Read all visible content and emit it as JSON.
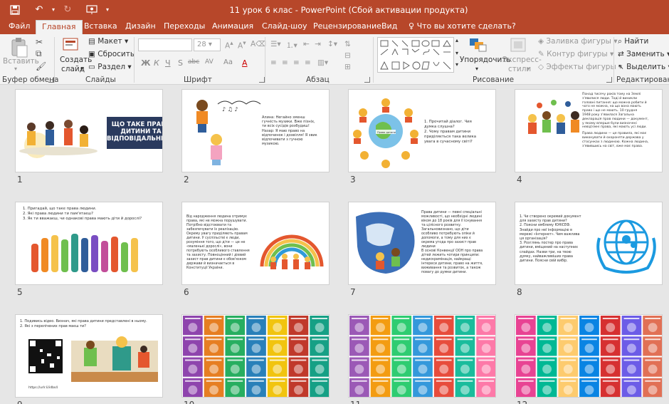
{
  "window": {
    "title": "11 урок 6 клас - PowerPoint (Сбой активации продукта)"
  },
  "tabs": [
    "Файл",
    "Главная",
    "Вставка",
    "Дизайн",
    "Переходы",
    "Анимация",
    "Слайд-шоу",
    "Рецензирование",
    "Вид"
  ],
  "active_tab": "Главная",
  "tell_me": "Что вы хотите сделать?",
  "ribbon": {
    "clipboard": {
      "paste": "Вставить",
      "label": "Буфер обмена"
    },
    "slides": {
      "new_slide": "Создать слайд",
      "new_slide_line1": "Создать",
      "new_slide_line2": "слайд",
      "layout": "Макет",
      "reset": "Сбросить",
      "section": "Раздел",
      "label": "Слайды"
    },
    "font": {
      "size": "28",
      "bold": "Ж",
      "italic": "К",
      "underline": "Ч",
      "strike": "S",
      "shadow": "abc",
      "spacing": "AV",
      "case": "Aa",
      "color": "A",
      "label": "Шрифт"
    },
    "paragraph": {
      "label": "Абзац"
    },
    "drawing": {
      "arrange": "Упорядочить",
      "quick_styles": "Экспресс-стили",
      "quick_styles_line1": "Экспресс-",
      "quick_styles_line2": "стили",
      "fill": "Заливка фигуры",
      "outline": "Контур фигуры",
      "effects": "Эффекты фигуры",
      "label": "Рисование"
    },
    "editing": {
      "find": "Найти",
      "replace": "Заменить",
      "select": "Выделить",
      "label": "Редактирование"
    }
  },
  "slides": [
    {
      "num": "1",
      "title": "ЩО ТАКЕ ПРАВА ДИТИНИ ТА ВІДПОВІДАЛЬНІСТЬ?"
    },
    {
      "num": "2",
      "lines": [
        "Алина: Негайно зменш",
        "гучність музики. Вже пізніх,",
        "ти всіх сусідів розбудиш!",
        "Назар: Я маю право на",
        "відпочинок і дозвілля! Я звик",
        "відпочивати з гучною",
        "музикою."
      ]
    },
    {
      "num": "3",
      "lines": [
        "1. Прочитай діалог. Чия",
        "    думка слушна?",
        "2. Чому правам дитини",
        "    приділяється така велика",
        "    увага в сучасному світі?"
      ],
      "label": "Права дитини"
    },
    {
      "num": "4",
      "lines": [
        "Понад тисячу років тому на Землі",
        "з'явилися люди. Тоді й виникли",
        "головні питання: що можна робити й",
        "чого не можна, на що вона мають",
        "право і що не мають. 10 грудня",
        "1948 року з'явилася Загальна",
        "декларація прав людини — документ,",
        "у якому вперше були визначені",
        "невід'ємні права, які мають усі люди.",
        "",
        "Права людини — це правила, які має",
        "виконувати й охороняти держава у",
        "стосунках з людиною. Кожна людина,",
        "з'явившись на світ, вже має права."
      ]
    },
    {
      "num": "5",
      "lines": [
        "1.  Пригадай, що таке права людини.",
        "2.  Які права людини ти пам'ятаєш?",
        "3.  Як ти вважаєш, чи однакові права мають діти й дорослі?"
      ]
    },
    {
      "num": "6",
      "lines": [
        "Від народження людина отримує",
        "права, які не можна порушувати.",
        "Потрібно відстоювати та",
        "забезпечувати їх реалізацію.",
        "Окрему увагу приділяють правам",
        "дитини. У суспільстві є люди,",
        "розуміння того, що діти — це не",
        "«маленькі дорослі», вони",
        "потребують особливого ставлення",
        "та захисту. Повноцінний і дієвий",
        "захист прав дитини є обов'язком",
        "держави й визначається в",
        "Конституції України."
      ]
    },
    {
      "num": "7",
      "lines": [
        "Права дитини — певні спеціальні",
        "можливості, що необхідні людині",
        "віком до 18 років для її існування",
        "та цілісного розвитку.",
        "Загальновизнано, що діти",
        "особливо потребують опіки й",
        "допомоги, а тому для них є",
        "окрема угода про захист прав",
        "людини",
        "В основі Конвенції ООН про права",
        "дітей лежить чотири принципи:",
        "недискримінація, найкращі",
        "інтереси дитини, право на життя,",
        "виживання та розвиток, а також",
        "повагу до думки дитини."
      ]
    },
    {
      "num": "8",
      "lines": [
        "1. Чи створено окремий документ",
        "для захисту прав дитини?",
        "2. Поясни емблему ЮНІСЕФ.",
        "Знайди про неї інформацію в",
        "мережі «Інтернет». Чим важлива",
        "ця організація?",
        "3. Розглянь постер про права",
        "дитини, вміщений на наступних",
        "слайдах. Назви три, на твою",
        "думку, найважливіших права",
        "дитини. Поясни свій вибір."
      ]
    },
    {
      "num": "9",
      "lines": [
        "1. Подивись відео. Визнач, які права дитини представлені в ньому.",
        "2. Які з перелічених прав маєш ти?"
      ],
      "link": "https://urlr.li/idbs4"
    },
    {
      "num": "10"
    },
    {
      "num": "11"
    },
    {
      "num": "12"
    }
  ]
}
